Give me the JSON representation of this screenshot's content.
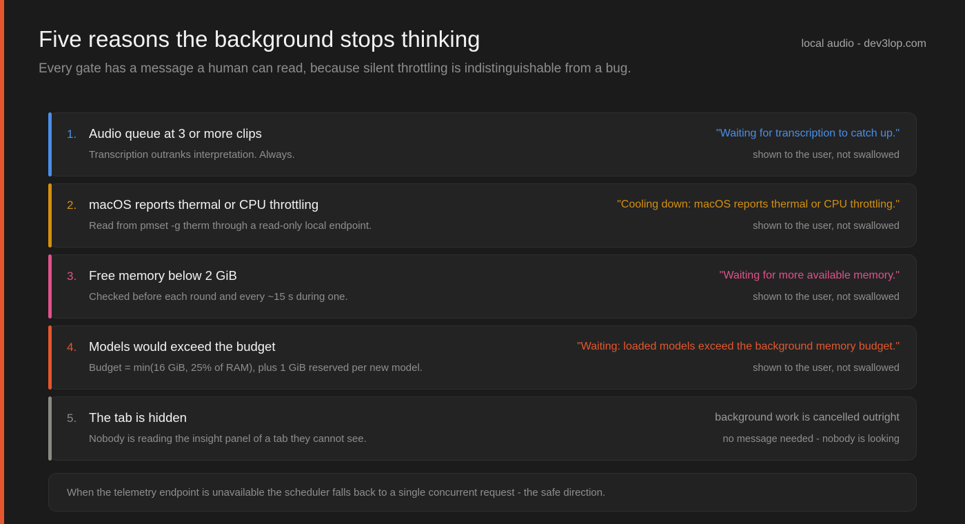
{
  "header": {
    "title": "Five reasons the background stops thinking",
    "subtitle": "Every gate has a message a human can read, because silent throttling is indistinguishable from a bug.",
    "brand": "local audio - dev3lop.com"
  },
  "colors": {
    "page_accent": "#e4572e",
    "background": "#1b1b1b"
  },
  "gates": [
    {
      "number": "1.",
      "title": "Audio queue at 3 or more clips",
      "description": "Transcription outranks interpretation. Always.",
      "message": "\"Waiting for transcription to catch up.\"",
      "note": "shown to the user, not swallowed",
      "color": "#4a8fe8",
      "message_color": "#4a8fe8"
    },
    {
      "number": "2.",
      "title": "macOS reports thermal or CPU throttling",
      "description": "Read from pmset -g therm through a read-only local endpoint.",
      "message": "\"Cooling down: macOS reports thermal or CPU throttling.\"",
      "note": "shown to the user, not swallowed",
      "color": "#d4900f",
      "message_color": "#d4900f"
    },
    {
      "number": "3.",
      "title": "Free memory below 2 GiB",
      "description": "Checked before each round and every ~15 s during one.",
      "message": "\"Waiting for more available memory.\"",
      "note": "shown to the user, not swallowed",
      "color": "#e0528a",
      "message_color": "#e0528a"
    },
    {
      "number": "4.",
      "title": "Models would exceed the budget",
      "description": "Budget = min(16 GiB, 25% of RAM), plus 1 GiB reserved per new model.",
      "message": "\"Waiting: loaded models exceed the background memory budget.\"",
      "note": "shown to the user, not swallowed",
      "color": "#e4572e",
      "message_color": "#e4572e"
    },
    {
      "number": "5.",
      "title": "The tab is hidden",
      "description": "Nobody is reading the insight panel of a tab they cannot see.",
      "message": "background work is cancelled outright",
      "note": "no message needed - nobody is looking",
      "color": "#8a8a85",
      "message_color": "#9a9a9a"
    }
  ],
  "footer": {
    "text": "When the telemetry endpoint is unavailable the scheduler falls back to a single concurrent request - the safe direction."
  }
}
